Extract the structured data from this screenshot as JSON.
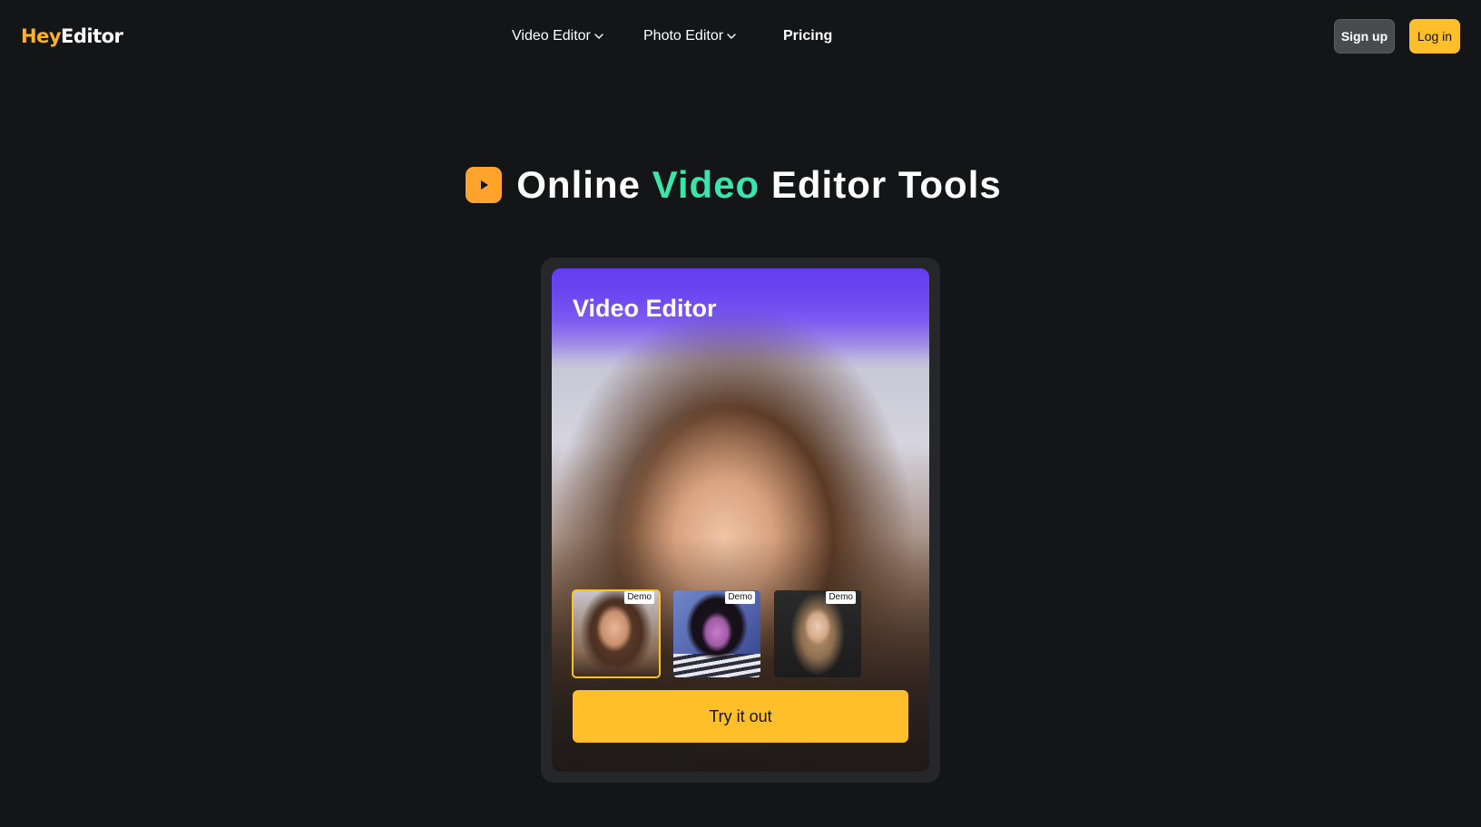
{
  "header": {
    "logo": {
      "part1": "Hey",
      "part2": "Editor"
    },
    "nav": {
      "video_editor": "Video Editor",
      "photo_editor": "Photo Editor",
      "pricing": "Pricing"
    },
    "signup_label": "Sign up",
    "login_label": "Log in"
  },
  "hero": {
    "title_part1": "Online",
    "title_accent": "Video",
    "title_part2": "Editor Tools",
    "accent_color": "#3ae4ad",
    "badge_icon": "play-icon"
  },
  "card": {
    "heading": "Video Editor",
    "thumbnails": [
      {
        "badge": "Demo",
        "selected": true
      },
      {
        "badge": "Demo",
        "selected": false
      },
      {
        "badge": "Demo",
        "selected": false
      }
    ],
    "cta_label": "Try it out"
  },
  "colors": {
    "background": "#141517",
    "brand_yellow": "#ffbf2a",
    "logo_yellow": "#ffb21e",
    "badge_orange": "#ffa32b"
  }
}
